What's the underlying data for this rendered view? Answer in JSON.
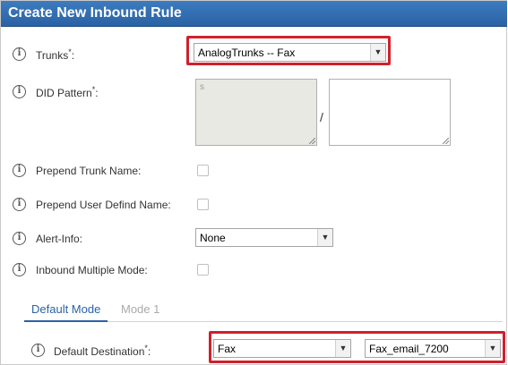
{
  "dialog": {
    "title": "Create New Inbound Rule"
  },
  "fields": {
    "trunks": {
      "label": "Trunks",
      "required": "*",
      "suffix": ":",
      "value": "AnalogTrunks -- Fax"
    },
    "did_pattern": {
      "label": "DID Pattern",
      "required": "*",
      "suffix": ":",
      "placeholder": "s",
      "separator": "/"
    },
    "prepend_trunk_name": {
      "label": "Prepend Trunk Name:",
      "checked": false
    },
    "prepend_user_name": {
      "label": "Prepend User Defind Name:",
      "checked": false
    },
    "alert_info": {
      "label": "Alert-Info:",
      "value": "None"
    },
    "inbound_multiple_mode": {
      "label": "Inbound Multiple Mode:",
      "checked": false
    }
  },
  "tabs": [
    {
      "label": "Default Mode",
      "active": true
    },
    {
      "label": "Mode 1",
      "active": false
    }
  ],
  "default_destination": {
    "label": "Default Destination",
    "required": "*",
    "suffix": ":",
    "type_value": "Fax",
    "target_value": "Fax_email_7200"
  },
  "icons": {
    "info": "info-icon",
    "dropdown": "chevron-down-icon"
  },
  "colors": {
    "title_bar": "#2f6db0",
    "highlight": "#d0202e",
    "active_tab": "#2a62a4"
  }
}
